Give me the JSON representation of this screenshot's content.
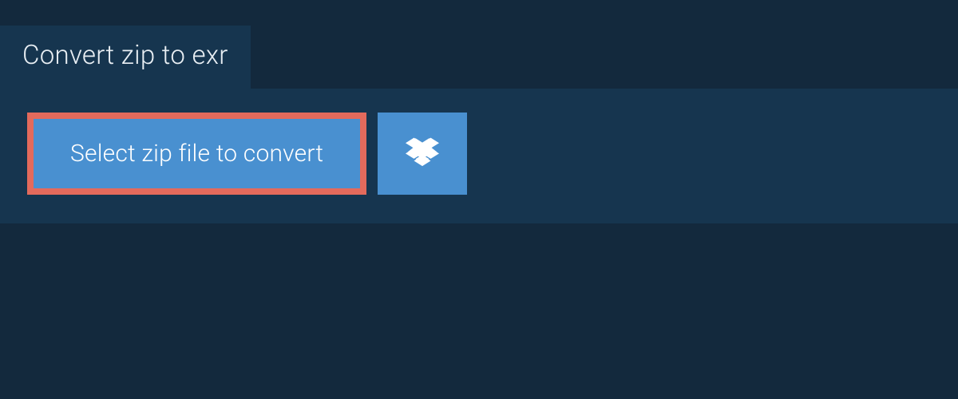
{
  "header": {
    "title": "Convert zip to exr"
  },
  "actions": {
    "select_label": "Select zip file to convert",
    "dropbox_icon": "dropbox-icon"
  },
  "colors": {
    "background": "#13293d",
    "panel": "#16354f",
    "button": "#4990d0",
    "highlight_border": "#e36a5c",
    "text_light": "#ffffff"
  }
}
